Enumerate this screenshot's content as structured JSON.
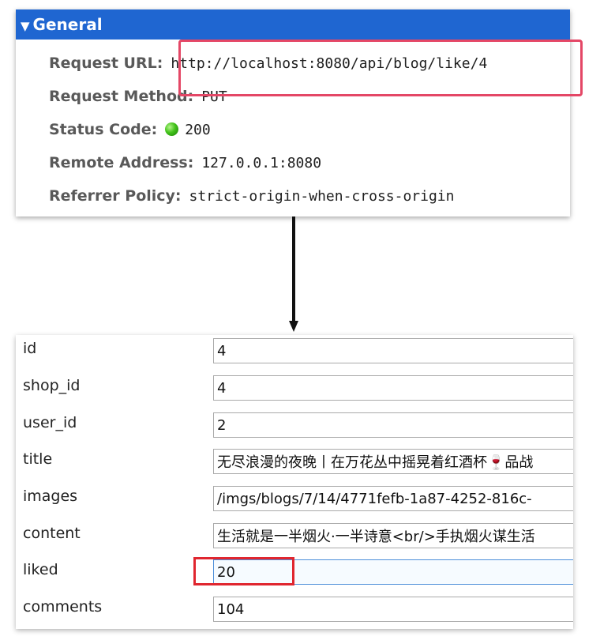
{
  "general": {
    "title": "General",
    "rows": [
      {
        "key": "Request URL:",
        "value": "http://localhost:8080/api/blog/like/4"
      },
      {
        "key": "Request Method:",
        "value": "PUT"
      },
      {
        "key": "Status Code:",
        "value": "200"
      },
      {
        "key": "Remote Address:",
        "value": "127.0.0.1:8080"
      },
      {
        "key": "Referrer Policy:",
        "value": "strict-origin-when-cross-origin"
      }
    ],
    "header_color": "#1f66d1",
    "status_color": "#42c21a"
  },
  "record": {
    "fields": [
      {
        "name": "id",
        "value": "4"
      },
      {
        "name": "shop_id",
        "value": "4"
      },
      {
        "name": "user_id",
        "value": "2"
      },
      {
        "name": "title",
        "value": "无尽浪漫的夜晚丨在万花丛中摇晃着红酒杯🍷品战"
      },
      {
        "name": "images",
        "value": "/imgs/blogs/7/14/4771fefb-1a87-4252-816c-"
      },
      {
        "name": "content",
        "value": "生活就是一半烟火·一半诗意<br/>手执烟火谋生活"
      },
      {
        "name": "liked",
        "value": "20"
      },
      {
        "name": "comments",
        "value": "104"
      }
    ]
  },
  "highlight_color": "#e0262f"
}
